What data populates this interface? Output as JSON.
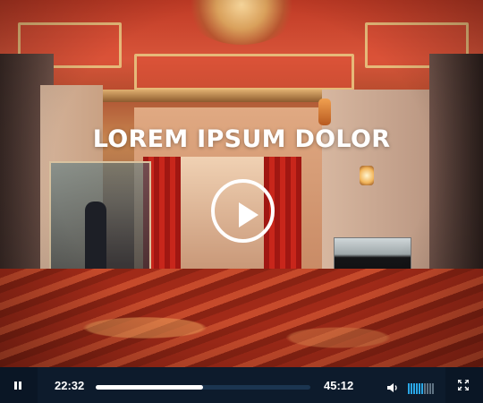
{
  "video": {
    "title": "LOREM IPSUM DOLOR",
    "state": "paused-overlay",
    "current_time": "22:32",
    "total_time": "45:12",
    "progress": 0.5,
    "volume_level": 0.6,
    "volume_bar_count": 10
  },
  "icons": {
    "big_play": "play-icon",
    "pause": "pause-icon",
    "volume": "speaker-icon",
    "fullscreen": "fullscreen-icon"
  },
  "colors": {
    "control_bar": "#0d1b2c",
    "button_bg": "#0a1625",
    "progress_track": "#1b3550",
    "progress_fill": "#ffffff",
    "volume_active": "#2aa8e8",
    "volume_inactive": "#5f7282"
  }
}
